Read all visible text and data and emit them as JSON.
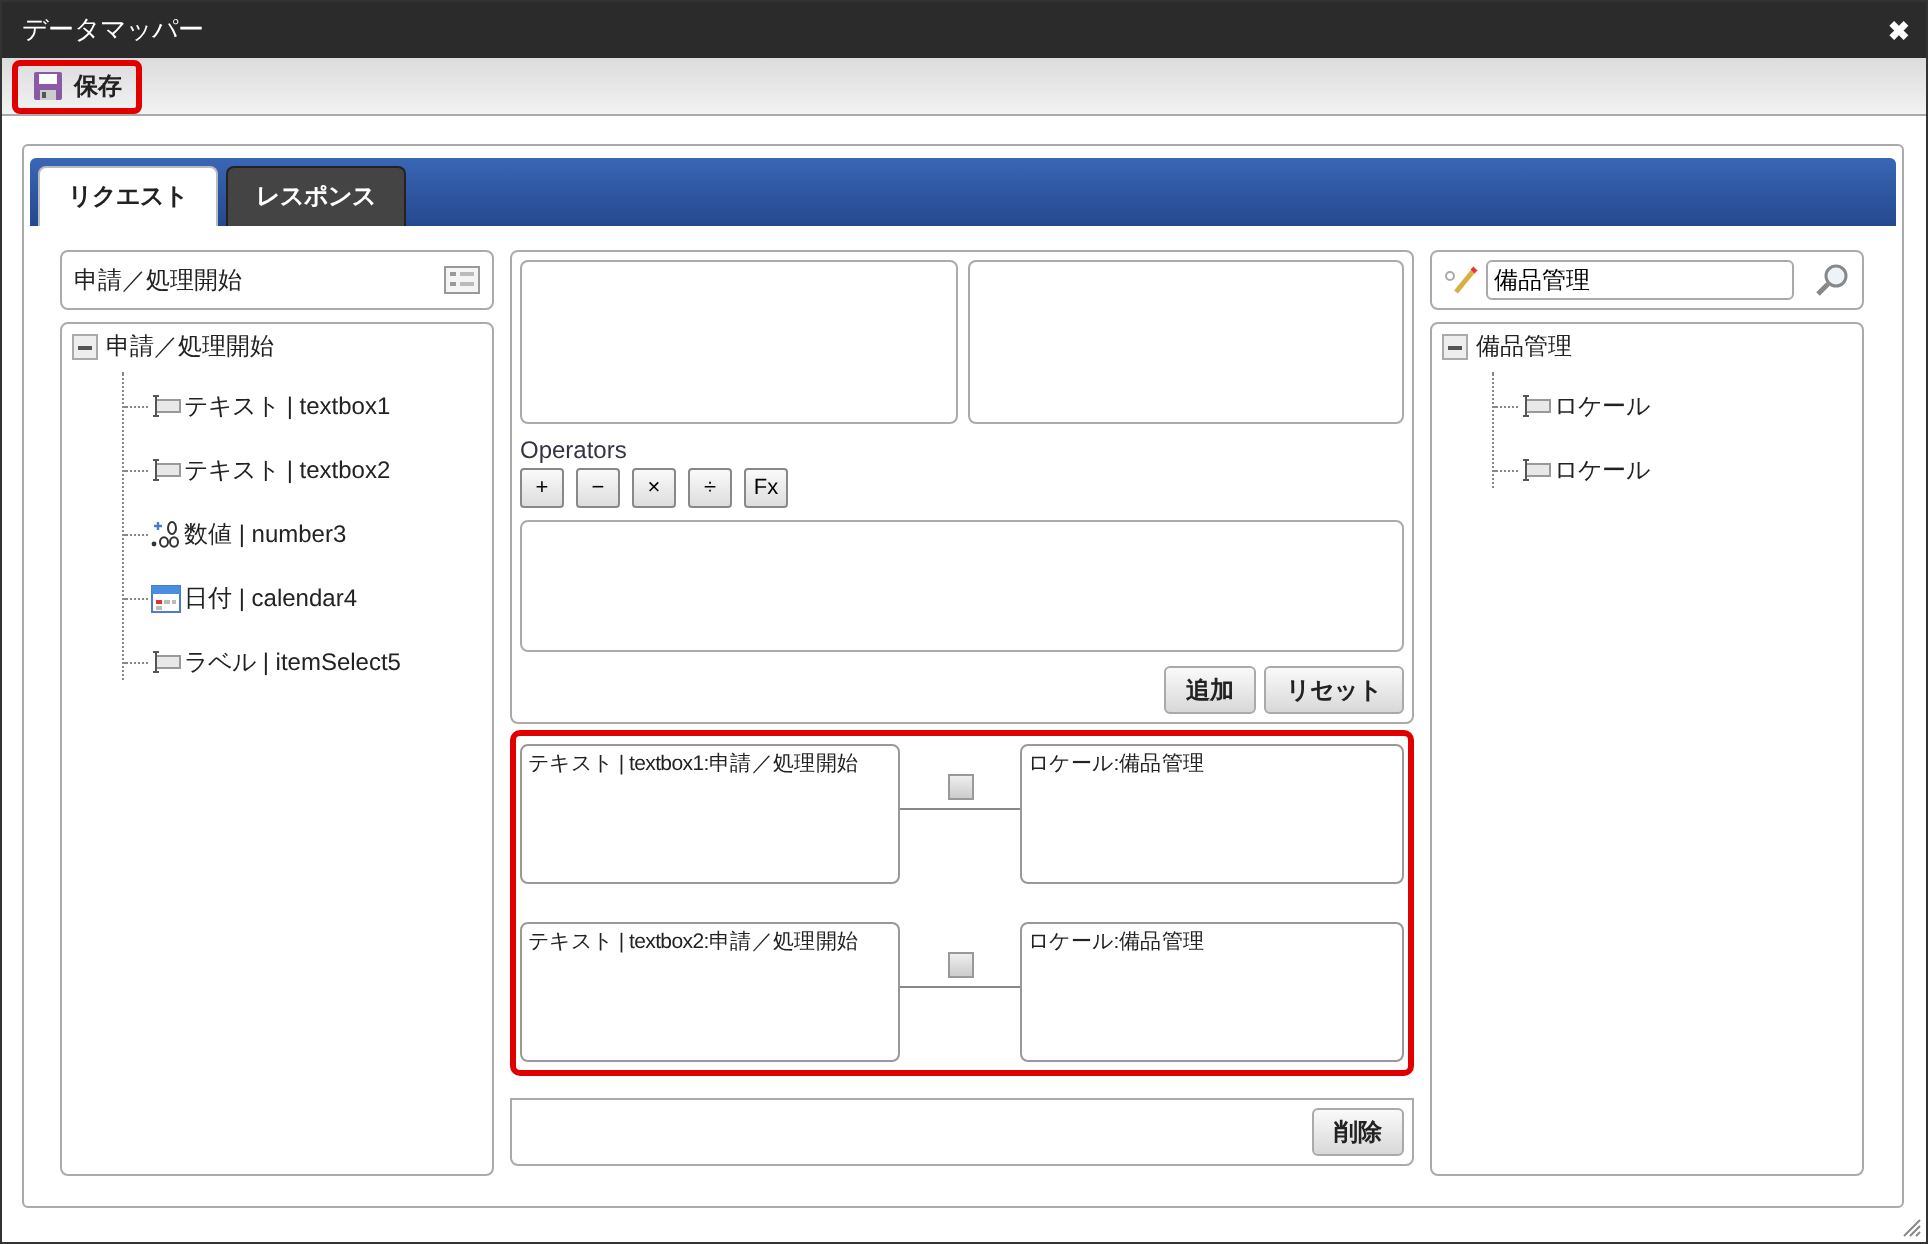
{
  "window": {
    "title": "データマッパー",
    "close": "✖"
  },
  "toolbar": {
    "save": {
      "label": "保存",
      "highlighted": true
    }
  },
  "tabs": [
    {
      "label": "リクエスト",
      "selected": true
    },
    {
      "label": "レスポンス",
      "selected": false
    }
  ],
  "source": {
    "title": "申請／処理開始",
    "tree": {
      "label": "申請／処理開始",
      "expanded": true,
      "children": [
        {
          "kind": "text",
          "label": "テキスト | textbox1"
        },
        {
          "kind": "text",
          "label": "テキスト | textbox2"
        },
        {
          "kind": "number",
          "label": "数値 | number3"
        },
        {
          "kind": "date",
          "label": "日付 | calendar4"
        },
        {
          "kind": "text",
          "label": "ラベル | itemSelect5"
        }
      ]
    }
  },
  "operators": {
    "label": "Operators",
    "buttons": [
      "+",
      "−",
      "×",
      "÷",
      "Fx"
    ]
  },
  "actions": [
    "追加",
    "リセット"
  ],
  "mappings": {
    "highlighted": true,
    "items": [
      {
        "source": "テキスト | textbox1:申請／処理開始",
        "checked": false,
        "target": "ロケール:備品管理"
      },
      {
        "source": "テキスト | textbox2:申請／処理開始",
        "checked": false,
        "target": "ロケール:備品管理"
      }
    ]
  },
  "delete_button": "削除",
  "target": {
    "search_value": "備品管理",
    "tree": {
      "label": "備品管理",
      "expanded": true,
      "children": [
        {
          "kind": "text",
          "label": "ロケール"
        },
        {
          "kind": "text",
          "label": "ロケール"
        }
      ]
    }
  }
}
